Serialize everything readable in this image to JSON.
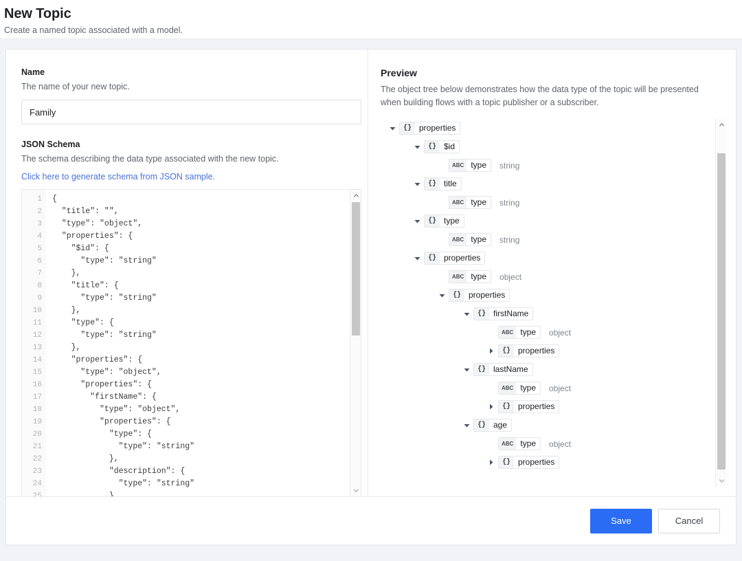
{
  "header": {
    "title": "New Topic",
    "subtitle": "Create a named topic associated with a model."
  },
  "form": {
    "name_label": "Name",
    "name_help": "The name of your new topic.",
    "name_value": "Family",
    "name_placeholder": "",
    "schema_label": "JSON Schema",
    "schema_help": "The schema describing the data type associated with the new topic.",
    "schema_link": "Click here to generate schema from JSON sample."
  },
  "editor": {
    "line_numbers": [
      "1",
      "2",
      "3",
      "4",
      "5",
      "6",
      "7",
      "8",
      "9",
      "10",
      "11",
      "12",
      "13",
      "14",
      "15",
      "16",
      "17",
      "18",
      "19",
      "20",
      "21",
      "22",
      "23",
      "24",
      "25"
    ],
    "code": "{\n  \"title\": \"\",\n  \"type\": \"object\",\n  \"properties\": {\n    \"$id\": {\n      \"type\": \"string\"\n    },\n    \"title\": {\n      \"type\": \"string\"\n    },\n    \"type\": {\n      \"type\": \"string\"\n    },\n    \"properties\": {\n      \"type\": \"object\",\n      \"properties\": {\n        \"firstName\": {\n          \"type\": \"object\",\n          \"properties\": {\n            \"type\": {\n              \"type\": \"string\"\n            },\n            \"description\": {\n              \"type\": \"string\"\n            }"
  },
  "preview": {
    "title": "Preview",
    "description": "The object tree below demonstrates how the data type of the topic will be presented when building flows with a topic publisher or a subscriber.",
    "tree": [
      {
        "indent": 0,
        "caret": "clipped",
        "badge": "{}",
        "badge_type": "object",
        "name": "",
        "value": ""
      },
      {
        "indent": 0,
        "caret": "open",
        "badge": "{}",
        "badge_type": "object",
        "name": "properties",
        "value": ""
      },
      {
        "indent": 1,
        "caret": "open",
        "badge": "{}",
        "badge_type": "object",
        "name": "$id",
        "value": ""
      },
      {
        "indent": 2,
        "caret": "none",
        "badge": "ABC",
        "badge_type": "string",
        "name": "type",
        "value": "string"
      },
      {
        "indent": 1,
        "caret": "open",
        "badge": "{}",
        "badge_type": "object",
        "name": "title",
        "value": ""
      },
      {
        "indent": 2,
        "caret": "none",
        "badge": "ABC",
        "badge_type": "string",
        "name": "type",
        "value": "string"
      },
      {
        "indent": 1,
        "caret": "open",
        "badge": "{}",
        "badge_type": "object",
        "name": "type",
        "value": ""
      },
      {
        "indent": 2,
        "caret": "none",
        "badge": "ABC",
        "badge_type": "string",
        "name": "type",
        "value": "string"
      },
      {
        "indent": 1,
        "caret": "open",
        "badge": "{}",
        "badge_type": "object",
        "name": "properties",
        "value": ""
      },
      {
        "indent": 2,
        "caret": "none",
        "badge": "ABC",
        "badge_type": "string",
        "name": "type",
        "value": "object"
      },
      {
        "indent": 2,
        "caret": "open",
        "badge": "{}",
        "badge_type": "object",
        "name": "properties",
        "value": ""
      },
      {
        "indent": 3,
        "caret": "open",
        "badge": "{}",
        "badge_type": "object",
        "name": "firstName",
        "value": ""
      },
      {
        "indent": 4,
        "caret": "none",
        "badge": "ABC",
        "badge_type": "string",
        "name": "type",
        "value": "object"
      },
      {
        "indent": 4,
        "caret": "closed",
        "badge": "{}",
        "badge_type": "object",
        "name": "properties",
        "value": ""
      },
      {
        "indent": 3,
        "caret": "open",
        "badge": "{}",
        "badge_type": "object",
        "name": "lastName",
        "value": ""
      },
      {
        "indent": 4,
        "caret": "none",
        "badge": "ABC",
        "badge_type": "string",
        "name": "type",
        "value": "object"
      },
      {
        "indent": 4,
        "caret": "closed",
        "badge": "{}",
        "badge_type": "object",
        "name": "properties",
        "value": ""
      },
      {
        "indent": 3,
        "caret": "open",
        "badge": "{}",
        "badge_type": "object",
        "name": "age",
        "value": ""
      },
      {
        "indent": 4,
        "caret": "none",
        "badge": "ABC",
        "badge_type": "string",
        "name": "type",
        "value": "object"
      },
      {
        "indent": 4,
        "caret": "closed",
        "badge": "{}",
        "badge_type": "object",
        "name": "properties",
        "value": ""
      }
    ]
  },
  "footer": {
    "save_label": "Save",
    "cancel_label": "Cancel"
  },
  "colors": {
    "primary": "#2a6df4",
    "link": "#4a72d6",
    "page_background": "#f1f3f6",
    "card_background": "#ffffff",
    "muted_text": "#5f6368"
  }
}
